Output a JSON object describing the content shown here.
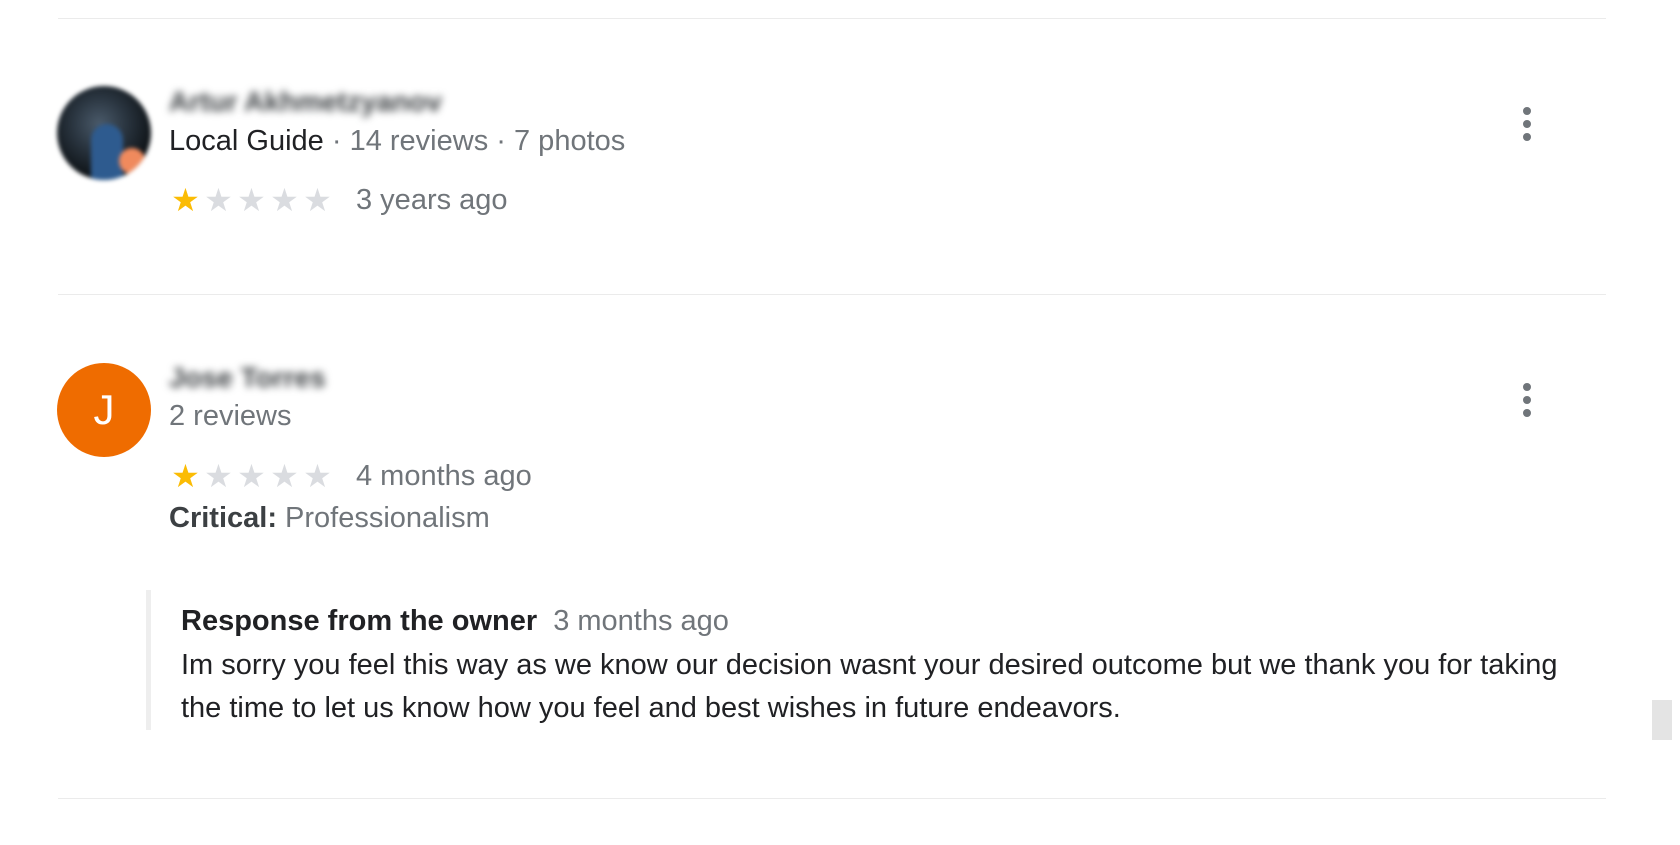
{
  "reviews": [
    {
      "name": "Artur Akhmetzyanov",
      "badge": "Local Guide",
      "reviews_count": "14 reviews",
      "photos_count": "7 photos",
      "rating": 1,
      "max_rating": 5,
      "age": "3 years ago"
    },
    {
      "name": "Jose Torres",
      "avatar_letter": "J",
      "reviews_count": "2 reviews",
      "rating": 1,
      "max_rating": 5,
      "age": "4 months ago",
      "critical_label": "Critical:",
      "critical_value": "Professionalism",
      "owner_response": {
        "title": "Response from the owner",
        "age": "3 months ago",
        "text": "Im sorry you feel this way as we know our decision wasnt your desired outcome but we thank you for taking the time to let us know how you feel and best wishes in future endeavors."
      }
    }
  ],
  "separator": "·",
  "colors": {
    "star_filled": "#fbbc04",
    "star_empty": "#dadce0",
    "avatar_bg": "#ef6c00"
  }
}
